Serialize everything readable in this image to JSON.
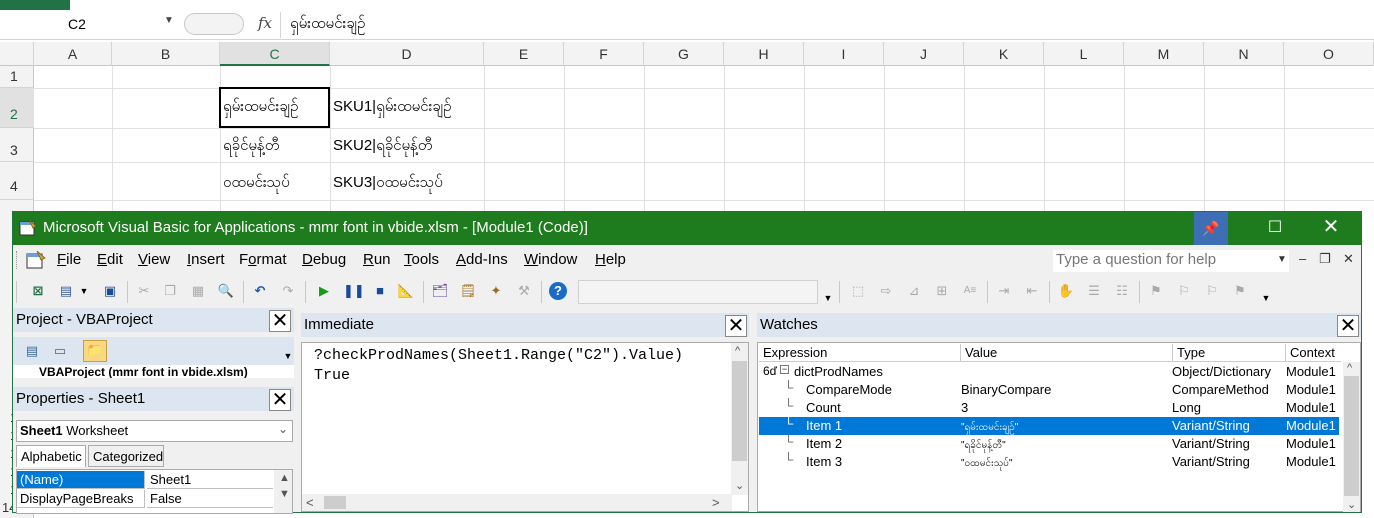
{
  "excel": {
    "name_box": "C2",
    "formula_fx": "fx",
    "formula_text": "ရှမ်းထမင်းချဉ်",
    "columns": [
      "A",
      "B",
      "C",
      "D",
      "E",
      "F",
      "G",
      "H",
      "I",
      "J",
      "K",
      "L",
      "M",
      "N",
      "O"
    ],
    "rows": [
      "1",
      "2",
      "3",
      "4"
    ],
    "hidden_rows": [
      "1",
      "1",
      "1",
      "1",
      "1",
      "1",
      "14"
    ],
    "cells": {
      "C2": "ရှမ်းထမင်းချဉ်",
      "D2": "SKU1|ရှမ်းထမင်းချဉ်",
      "C3": "ရခိုင်မုန့်တီ",
      "D3": "SKU2|ရခိုင်မုန့်တီ",
      "C4": "ဝထမင်းသုပ်",
      "D4": "SKU3|ဝထမင်းသုပ်"
    },
    "colors": {
      "accent": "#217346"
    }
  },
  "vbe": {
    "title": "Microsoft Visual Basic for Applications - mmr font in vbide.xlsm - [Module1 (Code)]",
    "pin_icon": "pin-icon",
    "maximize_glyph": "☐",
    "close_glyph": "✕",
    "menu": [
      {
        "label": "File",
        "u": "F",
        "rest": "ile"
      },
      {
        "label": "Edit",
        "u": "E",
        "rest": "dit"
      },
      {
        "label": "View",
        "u": "V",
        "rest": "iew"
      },
      {
        "label": "Insert",
        "u": "I",
        "rest": "nsert"
      },
      {
        "label": "Format",
        "u": "o",
        "pre": "F",
        "rest": "rmat"
      },
      {
        "label": "Debug",
        "u": "D",
        "rest": "ebug"
      },
      {
        "label": "Run",
        "u": "R",
        "rest": "un"
      },
      {
        "label": "Tools",
        "u": "T",
        "rest": "ools"
      },
      {
        "label": "Add-Ins",
        "u": "A",
        "rest": "dd-Ins"
      },
      {
        "label": "Window",
        "u": "W",
        "rest": "indow"
      },
      {
        "label": "Help",
        "u": "H",
        "rest": "elp"
      }
    ],
    "help_placeholder": "Type a question for help",
    "project": {
      "title": "Project - VBAProject",
      "tree_text": "VBAProject (mmr font in vbide.xlsm)"
    },
    "properties": {
      "title": "Properties - Sheet1",
      "object_name": "Sheet1",
      "object_type": "Worksheet",
      "tabs": [
        "Alphabetic",
        "Categorized"
      ],
      "rows": [
        {
          "name": "(Name)",
          "value": "Sheet1"
        },
        {
          "name": "DisplayPageBreaks",
          "value": "False"
        }
      ]
    },
    "immediate": {
      "title": "Immediate",
      "lines": [
        "?checkProdNames(Sheet1.Range(\"C2\").Value)",
        "True"
      ]
    },
    "watches": {
      "title": "Watches",
      "columns": [
        "Expression",
        "Value",
        "Type",
        "Context"
      ],
      "rows": [
        {
          "expr": "dictProdNames",
          "value": "",
          "type": "Object/Dictionary",
          "ctx": "Module1"
        },
        {
          "expr": "CompareMode",
          "value": "BinaryCompare",
          "type": "CompareMethod",
          "ctx": "Module1"
        },
        {
          "expr": "Count",
          "value": "3",
          "type": "Long",
          "ctx": "Module1"
        },
        {
          "expr": "Item 1",
          "value": "\"ရှမ်းထမင်းချဉ်\"",
          "type": "Variant/String",
          "ctx": "Module1"
        },
        {
          "expr": "Item 2",
          "value": "\"ရခိုင်မုန့်တီ\"",
          "type": "Variant/String",
          "ctx": "Module1"
        },
        {
          "expr": "Item 3",
          "value": "\"ဝထမင်းသုပ်\"",
          "type": "Variant/String",
          "ctx": "Module1"
        }
      ],
      "selected_row": 3
    },
    "colors": {
      "title_bg": "#1e7b1e",
      "pane_title_bg": "#dde6f0",
      "selection": "#0078d7"
    }
  }
}
